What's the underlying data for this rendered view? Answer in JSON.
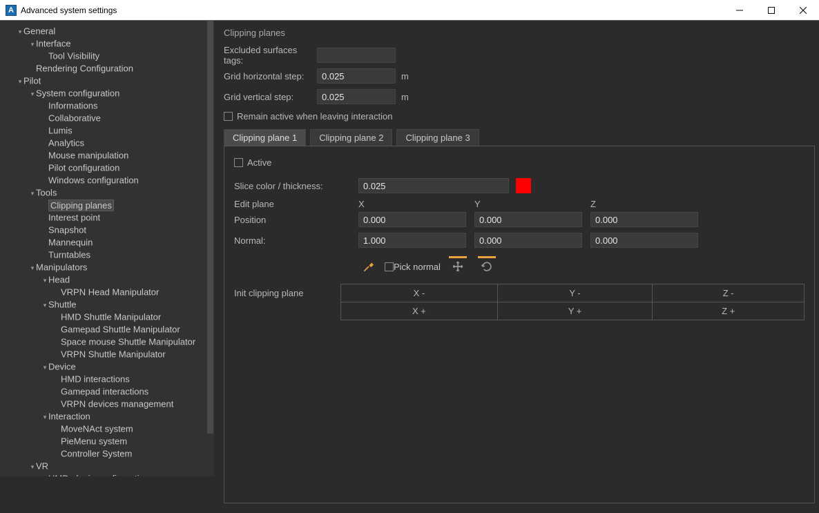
{
  "window": {
    "title": "Advanced system settings",
    "app_icon_letter": "A"
  },
  "sidebar": [
    {
      "indent": 1,
      "exp": "▾",
      "label": "General"
    },
    {
      "indent": 2,
      "exp": "▾",
      "label": "Interface"
    },
    {
      "indent": 3,
      "exp": "",
      "label": "Tool Visibility"
    },
    {
      "indent": 2,
      "exp": "",
      "label": "Rendering Configuration"
    },
    {
      "indent": 1,
      "exp": "▾",
      "label": "Pilot"
    },
    {
      "indent": 2,
      "exp": "▾",
      "label": "System configuration"
    },
    {
      "indent": 3,
      "exp": "",
      "label": "Informations"
    },
    {
      "indent": 3,
      "exp": "",
      "label": "Collaborative"
    },
    {
      "indent": 3,
      "exp": "",
      "label": "Lumis"
    },
    {
      "indent": 3,
      "exp": "",
      "label": "Analytics"
    },
    {
      "indent": 3,
      "exp": "",
      "label": "Mouse manipulation"
    },
    {
      "indent": 3,
      "exp": "",
      "label": "Pilot configuration"
    },
    {
      "indent": 3,
      "exp": "",
      "label": "Windows configuration"
    },
    {
      "indent": 2,
      "exp": "▾",
      "label": "Tools"
    },
    {
      "indent": 3,
      "exp": "",
      "label": "Clipping planes",
      "selected": true
    },
    {
      "indent": 3,
      "exp": "",
      "label": "Interest point"
    },
    {
      "indent": 3,
      "exp": "",
      "label": "Snapshot"
    },
    {
      "indent": 3,
      "exp": "",
      "label": "Mannequin"
    },
    {
      "indent": 3,
      "exp": "",
      "label": "Turntables"
    },
    {
      "indent": 2,
      "exp": "▾",
      "label": "Manipulators"
    },
    {
      "indent": 3,
      "exp": "▾",
      "label": "Head"
    },
    {
      "indent": 4,
      "exp": "",
      "label": "VRPN Head Manipulator"
    },
    {
      "indent": 3,
      "exp": "▾",
      "label": "Shuttle"
    },
    {
      "indent": 4,
      "exp": "",
      "label": "HMD Shuttle Manipulator"
    },
    {
      "indent": 4,
      "exp": "",
      "label": "Gamepad Shuttle Manipulator"
    },
    {
      "indent": 4,
      "exp": "",
      "label": "Space mouse Shuttle Manipulator"
    },
    {
      "indent": 4,
      "exp": "",
      "label": "VRPN Shuttle Manipulator"
    },
    {
      "indent": 3,
      "exp": "▾",
      "label": "Device"
    },
    {
      "indent": 4,
      "exp": "",
      "label": "HMD interactions"
    },
    {
      "indent": 4,
      "exp": "",
      "label": "Gamepad interactions"
    },
    {
      "indent": 4,
      "exp": "",
      "label": "VRPN devices management"
    },
    {
      "indent": 3,
      "exp": "▾",
      "label": "Interaction"
    },
    {
      "indent": 4,
      "exp": "",
      "label": "MoveNAct system"
    },
    {
      "indent": 4,
      "exp": "",
      "label": "PieMenu system"
    },
    {
      "indent": 4,
      "exp": "",
      "label": "Controller System"
    },
    {
      "indent": 2,
      "exp": "▾",
      "label": "VR"
    },
    {
      "indent": 3,
      "exp": "",
      "label": "HMD plugin configuration"
    }
  ],
  "main": {
    "section_title": "Clipping planes",
    "excluded_label": "Excluded surfaces tags:",
    "excluded_value": "",
    "grid_h_label": "Grid horizontal step:",
    "grid_h_value": "0.025",
    "grid_h_unit": "m",
    "grid_v_label": "Grid vertical step:",
    "grid_v_value": "0.025",
    "grid_v_unit": "m",
    "remain_active_label": "Remain active when leaving interaction",
    "tabs": [
      "Clipping plane 1",
      "Clipping plane 2",
      "Clipping plane 3"
    ],
    "active_tab": 0,
    "panel": {
      "active_label": "Active",
      "slice_label": "Slice color / thickness:",
      "slice_value": "0.025",
      "slice_color": "#ff0000",
      "edit_plane_label": "Edit plane",
      "col_x": "X",
      "col_y": "Y",
      "col_z": "Z",
      "position_label": "Position",
      "position": [
        "0.000",
        "0.000",
        "0.000"
      ],
      "normal_label": "Normal:",
      "normal": [
        "1.000",
        "0.000",
        "0.000"
      ],
      "pick_normal_label": "Pick normal",
      "init_label": "Init clipping plane",
      "init_grid": [
        [
          "X -",
          "Y -",
          "Z -"
        ],
        [
          "X +",
          "Y +",
          "Z +"
        ]
      ]
    }
  }
}
